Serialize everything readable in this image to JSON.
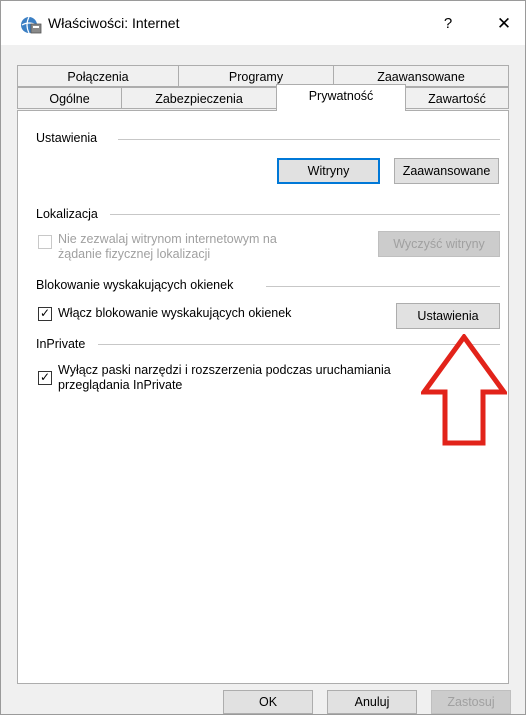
{
  "window": {
    "title": "Właściwości: Internet",
    "help_glyph": "?",
    "close_glyph": "✕",
    "icon": "internet-options-icon"
  },
  "tabs_back": [
    "Połączenia",
    "Programy",
    "Zaawansowane"
  ],
  "tabs_front": [
    "Ogólne",
    "Zabezpieczenia",
    "Prywatność",
    "Zawartość"
  ],
  "active_tab": "Prywatność",
  "settings": {
    "label": "Ustawienia",
    "sites_button": "Witryny",
    "advanced_button": "Zaawansowane"
  },
  "location": {
    "label": "Lokalizacja",
    "checkbox_line1": "Nie zezwalaj witrynom internetowym na",
    "checkbox_line2": "żądanie fizycznej lokalizacji",
    "checked": false,
    "clear_button": "Wyczyść witryny"
  },
  "popup_blocker": {
    "label": "Blokowanie wyskakujących okienek",
    "checkbox": "Włącz blokowanie wyskakujących okienek",
    "checked": true,
    "settings_button": "Ustawienia"
  },
  "inprivate": {
    "label": "InPrivate",
    "checkbox_line1": "Wyłącz paski narzędzi i rozszerzenia podczas uruchamiania",
    "checkbox_line2": "przeglądania InPrivate",
    "checked": true
  },
  "footer": {
    "ok": "OK",
    "cancel": "Anuluj",
    "apply": "Zastosuj"
  },
  "annotation": {
    "arrow_color": "#e2231a"
  }
}
